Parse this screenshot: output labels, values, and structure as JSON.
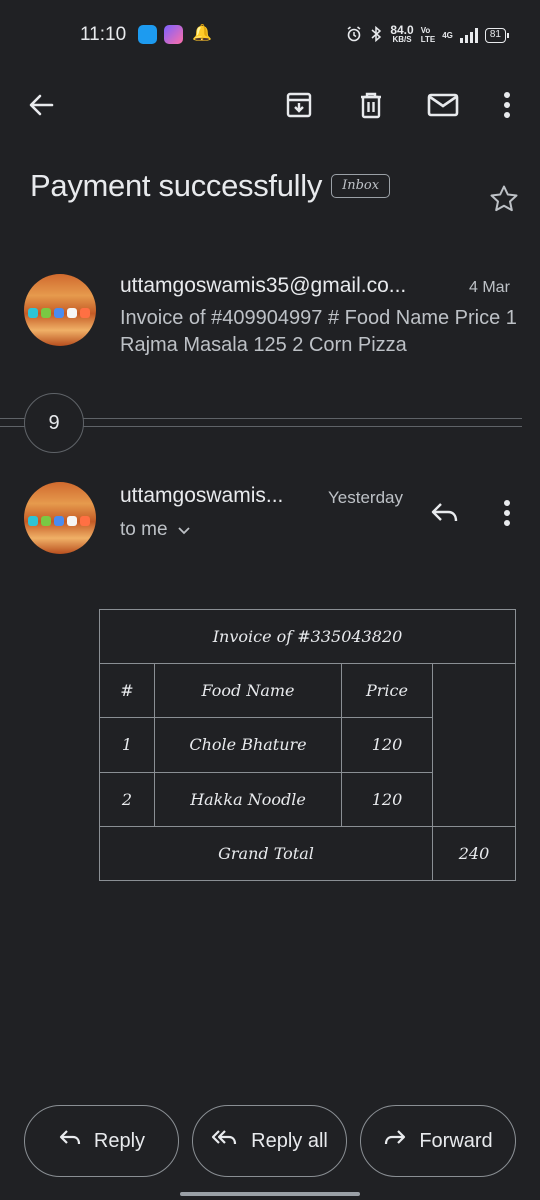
{
  "status_bar": {
    "time": "11:10",
    "speed_value": "84.0",
    "speed_unit": "KB/S",
    "network_top": "Vo",
    "network_bottom": "LTE",
    "network_type": "4G",
    "battery": "81"
  },
  "toolbar": {
    "icons": [
      "back-arrow-icon",
      "archive-icon",
      "delete-icon",
      "mark-unread-icon",
      "more-vert-icon"
    ]
  },
  "subject": {
    "title": "Payment successfully",
    "label": "Inbox"
  },
  "thread": {
    "collapsed_count": "9",
    "message1": {
      "sender": "uttamgoswamis35@gmail.co...",
      "date": "4 Mar",
      "snippet": "Invoice of #409904997 # Food Name Price 1 Rajma Masala 125 2 Corn Pizza"
    },
    "message2": {
      "sender": "uttamgoswamis...",
      "date": "Yesterday",
      "recipient": "to me"
    }
  },
  "invoice": {
    "title": "Invoice of #335043820",
    "headers": [
      "#",
      "Food Name",
      "Price"
    ],
    "rows": [
      {
        "num": "1",
        "name": "Chole Bhature",
        "price": "120"
      },
      {
        "num": "2",
        "name": "Hakka Noodle",
        "price": "120"
      }
    ],
    "total_label": "Grand Total",
    "total_value": "240"
  },
  "actions": {
    "reply": "Reply",
    "reply_all": "Reply all",
    "forward": "Forward"
  },
  "colors": {
    "background": "#202124",
    "text_primary": "#e8eaed",
    "text_secondary": "#bdc1c6",
    "border": "#8a8f94"
  }
}
